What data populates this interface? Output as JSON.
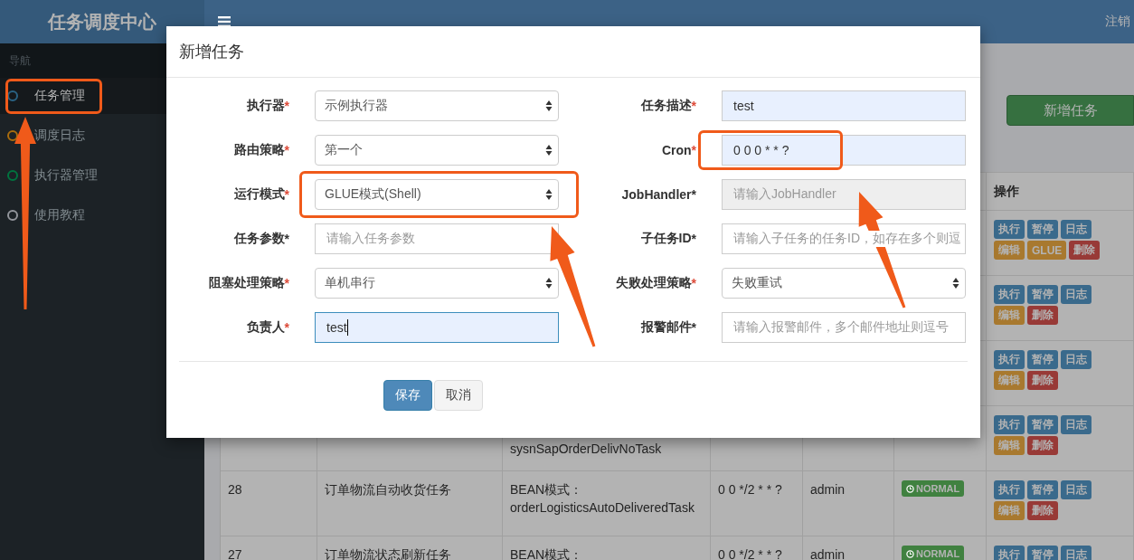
{
  "sidebar": {
    "title": "任务调度中心",
    "nav_heading": "导航",
    "items": [
      {
        "label": "任务管理",
        "color": "#2a6384",
        "selected": true,
        "highlighted": true
      },
      {
        "label": "调度日志",
        "color": "#aa6d0d",
        "selected": false,
        "highlighted": false
      },
      {
        "label": "执行器管理",
        "color": "#00743f",
        "selected": false,
        "highlighted": false
      },
      {
        "label": "使用教程",
        "color": "#93969c",
        "selected": false,
        "highlighted": false
      }
    ]
  },
  "header": {
    "logout": "注销"
  },
  "toolbar": {
    "add_button": "新增任务"
  },
  "table": {
    "ops_heading": "操作",
    "rows": [
      {
        "ops": [
          {
            "label": "执行",
            "kind": "primary"
          },
          {
            "label": "暂停",
            "kind": "primary"
          },
          {
            "label": "日志",
            "kind": "primary"
          },
          {
            "label": "编辑",
            "kind": "warning"
          },
          {
            "label": "GLUE",
            "kind": "warning"
          },
          {
            "label": "删除",
            "kind": "danger"
          }
        ]
      },
      {
        "ops": [
          {
            "label": "执行",
            "kind": "primary"
          },
          {
            "label": "暂停",
            "kind": "primary"
          },
          {
            "label": "日志",
            "kind": "primary"
          },
          {
            "label": "编辑",
            "kind": "warning"
          },
          {
            "label": "删除",
            "kind": "danger"
          }
        ]
      },
      {
        "ops": [
          {
            "label": "执行",
            "kind": "primary"
          },
          {
            "label": "暂停",
            "kind": "primary"
          },
          {
            "label": "日志",
            "kind": "primary"
          },
          {
            "label": "编辑",
            "kind": "warning"
          },
          {
            "label": "删除",
            "kind": "danger"
          }
        ]
      },
      {
        "handler": [
          "sysnSapOrderDelivNoTask"
        ],
        "ops": [
          {
            "label": "执行",
            "kind": "primary"
          },
          {
            "label": "暂停",
            "kind": "primary"
          },
          {
            "label": "日志",
            "kind": "primary"
          },
          {
            "label": "编辑",
            "kind": "warning"
          },
          {
            "label": "删除",
            "kind": "danger"
          }
        ]
      },
      {
        "id": "28",
        "name": "订单物流自动收货任务",
        "handler": [
          "BEAN模式：",
          "orderLogisticsAutoDeliveredTask"
        ],
        "cron": "0 0 */2 * * ?",
        "owner": "admin",
        "status": "NORMAL",
        "ops": [
          {
            "label": "执行",
            "kind": "primary"
          },
          {
            "label": "暂停",
            "kind": "primary"
          },
          {
            "label": "日志",
            "kind": "primary"
          },
          {
            "label": "编辑",
            "kind": "warning"
          },
          {
            "label": "删除",
            "kind": "danger"
          }
        ]
      },
      {
        "id": "27",
        "name": "订单物流状态刷新任务",
        "handler": [
          "BEAN模式："
        ],
        "cron": "0 0 */2 * * ?",
        "owner": "admin",
        "status": "NORMAL",
        "ops": [
          {
            "label": "执行",
            "kind": "primary"
          },
          {
            "label": "暂停",
            "kind": "primary"
          },
          {
            "label": "日志",
            "kind": "primary"
          }
        ]
      }
    ]
  },
  "dialog": {
    "title": "新增任务",
    "fields": [
      {
        "label": "执行器",
        "star": "*",
        "required": true,
        "kind": "select",
        "value": "示例执行器",
        "highlighted": false
      },
      {
        "label": "任务描述",
        "star": "*",
        "required": true,
        "kind": "input",
        "value": "test",
        "autofilled": true,
        "focused": false,
        "disabled": false,
        "highlighted": false
      },
      {
        "label": "路由策略",
        "star": "*",
        "required": true,
        "kind": "select",
        "value": "第一个",
        "highlighted": false
      },
      {
        "label": "Cron",
        "star": "*",
        "required": true,
        "kind": "input",
        "value": "0 0 0 * * ?",
        "autofilled": true,
        "focused": false,
        "disabled": false,
        "highlighted": true
      },
      {
        "label": "运行模式",
        "star": "*",
        "required": true,
        "kind": "select",
        "value": "GLUE模式(Shell)",
        "highlighted": true
      },
      {
        "label": "JobHandler",
        "star": "*",
        "required": false,
        "kind": "input",
        "placeholder": "请输入JobHandler",
        "autofilled": false,
        "focused": false,
        "disabled": true,
        "highlighted": false
      },
      {
        "label": "任务参数",
        "star": "*",
        "required": false,
        "kind": "input",
        "placeholder": "请输入任务参数",
        "autofilled": false,
        "focused": false,
        "disabled": false,
        "highlighted": false
      },
      {
        "label": "子任务ID",
        "star": "*",
        "required": false,
        "kind": "input",
        "placeholder": "请输入子任务的任务ID，如存在多个则逗",
        "autofilled": false,
        "focused": false,
        "disabled": false,
        "highlighted": false
      },
      {
        "label": "阻塞处理策略",
        "star": "*",
        "required": true,
        "kind": "select",
        "value": "单机串行",
        "highlighted": false
      },
      {
        "label": "失败处理策略",
        "star": "*",
        "required": true,
        "kind": "select",
        "value": "失败重试",
        "highlighted": false
      },
      {
        "label": "负责人",
        "star": "*",
        "required": true,
        "kind": "input",
        "value": "test",
        "autofilled": true,
        "focused": true,
        "disabled": false,
        "highlighted": false
      },
      {
        "label": "报警邮件",
        "star": "*",
        "required": false,
        "kind": "input",
        "placeholder": "请输入报警邮件，多个邮件地址则逗号",
        "autofilled": false,
        "focused": false,
        "disabled": false,
        "highlighted": false
      }
    ],
    "buttons": [
      {
        "label": "保存",
        "kind": "primary"
      },
      {
        "label": "取消",
        "kind": "default"
      }
    ]
  }
}
